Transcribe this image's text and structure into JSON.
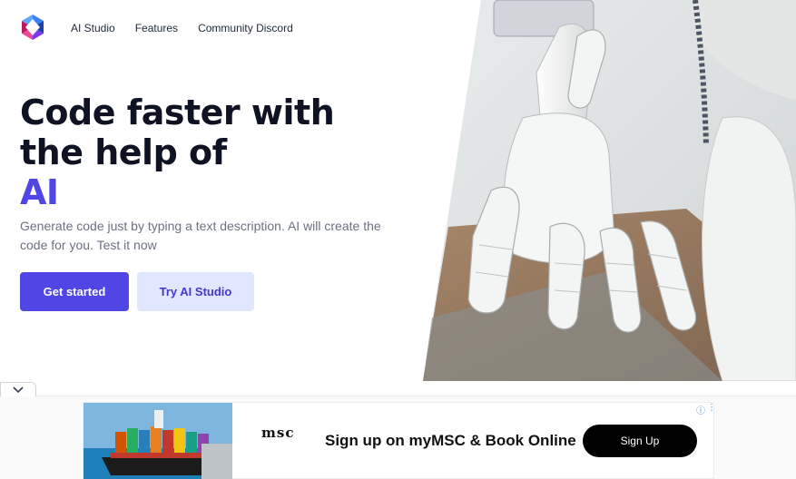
{
  "nav": {
    "items": [
      {
        "label": "AI Studio"
      },
      {
        "label": "Features"
      },
      {
        "label": "Community Discord"
      }
    ]
  },
  "hero": {
    "title": "Code faster with the help of",
    "title_accent": "AI",
    "subtitle": "Generate code just by typing a text description. AI will create the code for you. Test it now",
    "primary_button": "Get started",
    "secondary_button": "Try AI Studio"
  },
  "ad": {
    "brand_line1": "msc",
    "headline": "Sign up on myMSC & Book Online",
    "cta": "Sign Up",
    "info_icon": "ⓘ",
    "more_icon": "⋮"
  },
  "colors": {
    "accent": "#4f46e5",
    "secondary_bg": "#e0e7ff",
    "text_dark": "#0f1222",
    "text_muted": "#6b7280"
  },
  "icons": [
    "logo-icon",
    "chevron-down-icon",
    "info-icon",
    "more-vertical-icon"
  ]
}
